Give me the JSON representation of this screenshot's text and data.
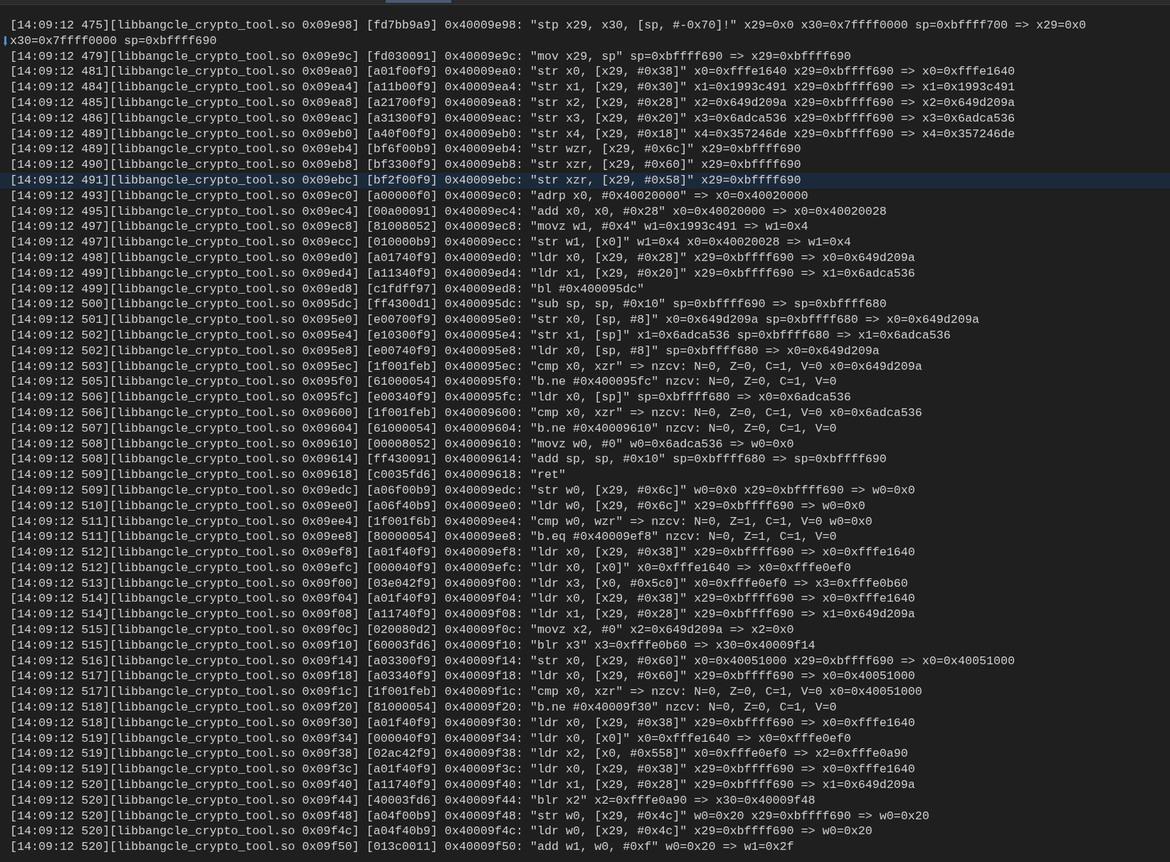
{
  "log": {
    "lines": [
      {
        "text": "[14:09:12 475][libbangcle_crypto_tool.so 0x09e98] [fd7bb9a9] 0x40009e98: \"stp x29, x30, [sp, #-0x70]!\" x29=0x0 x30=0x7ffff0000 sp=0xbffff700 => x29=0x0",
        "continuation": "x30=0x7ffff0000 sp=0xbffff690",
        "selected": false
      },
      {
        "text": "[14:09:12 479][libbangcle_crypto_tool.so 0x09e9c] [fd030091] 0x40009e9c: \"mov x29, sp\" sp=0xbffff690 => x29=0xbffff690",
        "selected": false
      },
      {
        "text": "[14:09:12 481][libbangcle_crypto_tool.so 0x09ea0] [a01f00f9] 0x40009ea0: \"str x0, [x29, #0x38]\" x0=0xfffe1640 x29=0xbffff690 => x0=0xfffe1640",
        "selected": false
      },
      {
        "text": "[14:09:12 484][libbangcle_crypto_tool.so 0x09ea4] [a11b00f9] 0x40009ea4: \"str x1, [x29, #0x30]\" x1=0x1993c491 x29=0xbffff690 => x1=0x1993c491",
        "selected": false
      },
      {
        "text": "[14:09:12 485][libbangcle_crypto_tool.so 0x09ea8] [a21700f9] 0x40009ea8: \"str x2, [x29, #0x28]\" x2=0x649d209a x29=0xbffff690 => x2=0x649d209a",
        "selected": false
      },
      {
        "text": "[14:09:12 486][libbangcle_crypto_tool.so 0x09eac] [a31300f9] 0x40009eac: \"str x3, [x29, #0x20]\" x3=0x6adca536 x29=0xbffff690 => x3=0x6adca536",
        "selected": false
      },
      {
        "text": "[14:09:12 489][libbangcle_crypto_tool.so 0x09eb0] [a40f00f9] 0x40009eb0: \"str x4, [x29, #0x18]\" x4=0x357246de x29=0xbffff690 => x4=0x357246de",
        "selected": false
      },
      {
        "text": "[14:09:12 489][libbangcle_crypto_tool.so 0x09eb4] [bf6f00b9] 0x40009eb4: \"str wzr, [x29, #0x6c]\" x29=0xbffff690",
        "selected": false
      },
      {
        "text": "[14:09:12 490][libbangcle_crypto_tool.so 0x09eb8] [bf3300f9] 0x40009eb8: \"str xzr, [x29, #0x60]\" x29=0xbffff690",
        "selected": false
      },
      {
        "text": "[14:09:12 491][libbangcle_crypto_tool.so 0x09ebc] [bf2f00f9] 0x40009ebc: \"str xzr, [x29, #0x58]\" x29=0xbffff690",
        "selected": true
      },
      {
        "text": "[14:09:12 493][libbangcle_crypto_tool.so 0x09ec0] [a00000f0] 0x40009ec0: \"adrp x0, #0x40020000\" => x0=0x40020000",
        "selected": false
      },
      {
        "text": "[14:09:12 495][libbangcle_crypto_tool.so 0x09ec4] [00a00091] 0x40009ec4: \"add x0, x0, #0x28\" x0=0x40020000 => x0=0x40020028",
        "selected": false
      },
      {
        "text": "[14:09:12 497][libbangcle_crypto_tool.so 0x09ec8] [81008052] 0x40009ec8: \"movz w1, #0x4\" w1=0x1993c491 => w1=0x4",
        "selected": false
      },
      {
        "text": "[14:09:12 497][libbangcle_crypto_tool.so 0x09ecc] [010000b9] 0x40009ecc: \"str w1, [x0]\" w1=0x4 x0=0x40020028 => w1=0x4",
        "selected": false
      },
      {
        "text": "[14:09:12 498][libbangcle_crypto_tool.so 0x09ed0] [a01740f9] 0x40009ed0: \"ldr x0, [x29, #0x28]\" x29=0xbffff690 => x0=0x649d209a",
        "selected": false
      },
      {
        "text": "[14:09:12 499][libbangcle_crypto_tool.so 0x09ed4] [a11340f9] 0x40009ed4: \"ldr x1, [x29, #0x20]\" x29=0xbffff690 => x1=0x6adca536",
        "selected": false
      },
      {
        "text": "[14:09:12 499][libbangcle_crypto_tool.so 0x09ed8] [c1fdff97] 0x40009ed8: \"bl #0x400095dc\"",
        "selected": false
      },
      {
        "text": "[14:09:12 500][libbangcle_crypto_tool.so 0x095dc] [ff4300d1] 0x400095dc: \"sub sp, sp, #0x10\" sp=0xbffff690 => sp=0xbffff680",
        "selected": false
      },
      {
        "text": "[14:09:12 501][libbangcle_crypto_tool.so 0x095e0] [e00700f9] 0x400095e0: \"str x0, [sp, #8]\" x0=0x649d209a sp=0xbffff680 => x0=0x649d209a",
        "selected": false
      },
      {
        "text": "[14:09:12 502][libbangcle_crypto_tool.so 0x095e4] [e10300f9] 0x400095e4: \"str x1, [sp]\" x1=0x6adca536 sp=0xbffff680 => x1=0x6adca536",
        "selected": false
      },
      {
        "text": "[14:09:12 502][libbangcle_crypto_tool.so 0x095e8] [e00740f9] 0x400095e8: \"ldr x0, [sp, #8]\" sp=0xbffff680 => x0=0x649d209a",
        "selected": false
      },
      {
        "text": "[14:09:12 503][libbangcle_crypto_tool.so 0x095ec] [1f001feb] 0x400095ec: \"cmp x0, xzr\" => nzcv: N=0, Z=0, C=1, V=0 x0=0x649d209a",
        "selected": false
      },
      {
        "text": "[14:09:12 505][libbangcle_crypto_tool.so 0x095f0] [61000054] 0x400095f0: \"b.ne #0x400095fc\" nzcv: N=0, Z=0, C=1, V=0",
        "selected": false
      },
      {
        "text": "[14:09:12 506][libbangcle_crypto_tool.so 0x095fc] [e00340f9] 0x400095fc: \"ldr x0, [sp]\" sp=0xbffff680 => x0=0x6adca536",
        "selected": false
      },
      {
        "text": "[14:09:12 506][libbangcle_crypto_tool.so 0x09600] [1f001feb] 0x40009600: \"cmp x0, xzr\" => nzcv: N=0, Z=0, C=1, V=0 x0=0x6adca536",
        "selected": false
      },
      {
        "text": "[14:09:12 507][libbangcle_crypto_tool.so 0x09604] [61000054] 0x40009604: \"b.ne #0x40009610\" nzcv: N=0, Z=0, C=1, V=0",
        "selected": false
      },
      {
        "text": "[14:09:12 508][libbangcle_crypto_tool.so 0x09610] [00008052] 0x40009610: \"movz w0, #0\" w0=0x6adca536 => w0=0x0",
        "selected": false
      },
      {
        "text": "[14:09:12 508][libbangcle_crypto_tool.so 0x09614] [ff430091] 0x40009614: \"add sp, sp, #0x10\" sp=0xbffff680 => sp=0xbffff690",
        "selected": false
      },
      {
        "text": "[14:09:12 509][libbangcle_crypto_tool.so 0x09618] [c0035fd6] 0x40009618: \"ret\"",
        "selected": false
      },
      {
        "text": "[14:09:12 509][libbangcle_crypto_tool.so 0x09edc] [a06f00b9] 0x40009edc: \"str w0, [x29, #0x6c]\" w0=0x0 x29=0xbffff690 => w0=0x0",
        "selected": false
      },
      {
        "text": "[14:09:12 510][libbangcle_crypto_tool.so 0x09ee0] [a06f40b9] 0x40009ee0: \"ldr w0, [x29, #0x6c]\" x29=0xbffff690 => w0=0x0",
        "selected": false
      },
      {
        "text": "[14:09:12 511][libbangcle_crypto_tool.so 0x09ee4] [1f001f6b] 0x40009ee4: \"cmp w0, wzr\" => nzcv: N=0, Z=1, C=1, V=0 w0=0x0",
        "selected": false
      },
      {
        "text": "[14:09:12 511][libbangcle_crypto_tool.so 0x09ee8] [80000054] 0x40009ee8: \"b.eq #0x40009ef8\" nzcv: N=0, Z=1, C=1, V=0",
        "selected": false
      },
      {
        "text": "[14:09:12 512][libbangcle_crypto_tool.so 0x09ef8] [a01f40f9] 0x40009ef8: \"ldr x0, [x29, #0x38]\" x29=0xbffff690 => x0=0xfffe1640",
        "selected": false
      },
      {
        "text": "[14:09:12 512][libbangcle_crypto_tool.so 0x09efc] [000040f9] 0x40009efc: \"ldr x0, [x0]\" x0=0xfffe1640 => x0=0xfffe0ef0",
        "selected": false
      },
      {
        "text": "[14:09:12 513][libbangcle_crypto_tool.so 0x09f00] [03e042f9] 0x40009f00: \"ldr x3, [x0, #0x5c0]\" x0=0xfffe0ef0 => x3=0xfffe0b60",
        "selected": false
      },
      {
        "text": "[14:09:12 514][libbangcle_crypto_tool.so 0x09f04] [a01f40f9] 0x40009f04: \"ldr x0, [x29, #0x38]\" x29=0xbffff690 => x0=0xfffe1640",
        "selected": false
      },
      {
        "text": "[14:09:12 514][libbangcle_crypto_tool.so 0x09f08] [a11740f9] 0x40009f08: \"ldr x1, [x29, #0x28]\" x29=0xbffff690 => x1=0x649d209a",
        "selected": false
      },
      {
        "text": "[14:09:12 515][libbangcle_crypto_tool.so 0x09f0c] [020080d2] 0x40009f0c: \"movz x2, #0\" x2=0x649d209a => x2=0x0",
        "selected": false
      },
      {
        "text": "[14:09:12 515][libbangcle_crypto_tool.so 0x09f10] [60003fd6] 0x40009f10: \"blr x3\" x3=0xfffe0b60 => x30=0x40009f14",
        "selected": false
      },
      {
        "text": "[14:09:12 516][libbangcle_crypto_tool.so 0x09f14] [a03300f9] 0x40009f14: \"str x0, [x29, #0x60]\" x0=0x40051000 x29=0xbffff690 => x0=0x40051000",
        "selected": false
      },
      {
        "text": "[14:09:12 517][libbangcle_crypto_tool.so 0x09f18] [a03340f9] 0x40009f18: \"ldr x0, [x29, #0x60]\" x29=0xbffff690 => x0=0x40051000",
        "selected": false
      },
      {
        "text": "[14:09:12 517][libbangcle_crypto_tool.so 0x09f1c] [1f001feb] 0x40009f1c: \"cmp x0, xzr\" => nzcv: N=0, Z=0, C=1, V=0 x0=0x40051000",
        "selected": false
      },
      {
        "text": "[14:09:12 518][libbangcle_crypto_tool.so 0x09f20] [81000054] 0x40009f20: \"b.ne #0x40009f30\" nzcv: N=0, Z=0, C=1, V=0",
        "selected": false
      },
      {
        "text": "[14:09:12 518][libbangcle_crypto_tool.so 0x09f30] [a01f40f9] 0x40009f30: \"ldr x0, [x29, #0x38]\" x29=0xbffff690 => x0=0xfffe1640",
        "selected": false
      },
      {
        "text": "[14:09:12 519][libbangcle_crypto_tool.so 0x09f34] [000040f9] 0x40009f34: \"ldr x0, [x0]\" x0=0xfffe1640 => x0=0xfffe0ef0",
        "selected": false
      },
      {
        "text": "[14:09:12 519][libbangcle_crypto_tool.so 0x09f38] [02ac42f9] 0x40009f38: \"ldr x2, [x0, #0x558]\" x0=0xfffe0ef0 => x2=0xfffe0a90",
        "selected": false
      },
      {
        "text": "[14:09:12 519][libbangcle_crypto_tool.so 0x09f3c] [a01f40f9] 0x40009f3c: \"ldr x0, [x29, #0x38]\" x29=0xbffff690 => x0=0xfffe1640",
        "selected": false
      },
      {
        "text": "[14:09:12 520][libbangcle_crypto_tool.so 0x09f40] [a11740f9] 0x40009f40: \"ldr x1, [x29, #0x28]\" x29=0xbffff690 => x1=0x649d209a",
        "selected": false
      },
      {
        "text": "[14:09:12 520][libbangcle_crypto_tool.so 0x09f44] [40003fd6] 0x40009f44: \"blr x2\" x2=0xfffe0a90 => x30=0x40009f48",
        "selected": false
      },
      {
        "text": "[14:09:12 520][libbangcle_crypto_tool.so 0x09f48] [a04f00b9] 0x40009f48: \"str w0, [x29, #0x4c]\" w0=0x20 x29=0xbffff690 => w0=0x20",
        "selected": false
      },
      {
        "text": "[14:09:12 520][libbangcle_crypto_tool.so 0x09f4c] [a04f40b9] 0x40009f4c: \"ldr w0, [x29, #0x4c]\" x29=0xbffff690 => w0=0x20",
        "selected": false
      },
      {
        "text": "[14:09:12 520][libbangcle_crypto_tool.so 0x09f50] [013c0011] 0x40009f50: \"add w1, w0, #0xf\" w0=0x20 => w1=0x2f",
        "selected": false
      }
    ]
  }
}
